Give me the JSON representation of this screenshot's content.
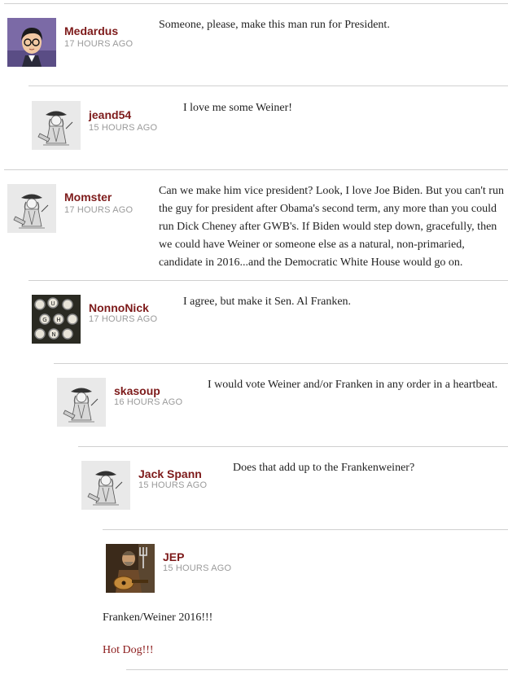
{
  "comments": [
    {
      "username": "Medardus",
      "time": "17 HOURS AGO",
      "avatar": "cartoon-man-glasses",
      "text": "Someone, please, make this man run for President."
    },
    {
      "username": "jeand54",
      "time": "15 HOURS AGO",
      "avatar": "colonial-figure-sketch",
      "text": "I love me some Weiner!"
    },
    {
      "username": "Momster",
      "time": "17 HOURS AGO",
      "avatar": "colonial-figure-sketch",
      "text": "Can we make him vice president? Look, I love Joe Biden. But you can't run the guy for president after Obama's second term, any more than you could run Dick Cheney after GWB's. If Biden would step down, gracefully, then we could have Weiner or someone else as a natural, non-primaried, candidate in 2016...and the Democratic White House would go on."
    },
    {
      "username": "NonnoNick",
      "time": "17 HOURS AGO",
      "avatar": "typewriter-keys",
      "text": "I agree, but make it Sen. Al Franken."
    },
    {
      "username": "skasoup",
      "time": "16 HOURS AGO",
      "avatar": "colonial-figure-sketch",
      "text": "I would vote Weiner and/or Franken in any order in a heartbeat."
    },
    {
      "username": "Jack Spann",
      "time": "15 HOURS AGO",
      "avatar": "colonial-figure-sketch",
      "text": "Does that add up to the Frankenweiner?"
    },
    {
      "username": "JEP",
      "time": "15 HOURS AGO",
      "avatar": "man-with-guitar-photo",
      "text": "Franken/Weiner 2016!!!",
      "text2": "Hot Dog!!!"
    }
  ],
  "colors": {
    "username": "#7d1a1a",
    "time": "#9a9a9a",
    "divider": "#d0d0d0",
    "hot_dog": "#8b1a1a"
  }
}
